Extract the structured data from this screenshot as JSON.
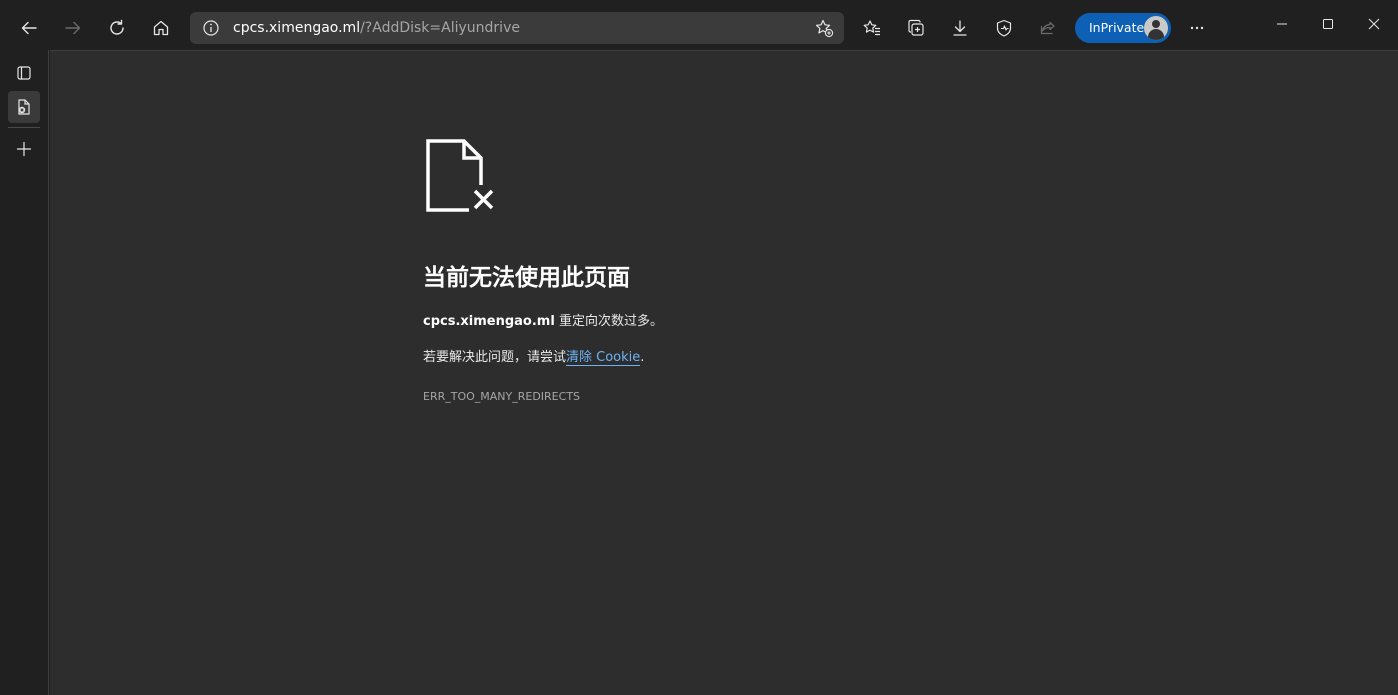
{
  "address_bar": {
    "host": "cpcs.ximengao.ml",
    "path": "/?AddDisk=Aliyundrive"
  },
  "profile": {
    "label": "InPrivate"
  },
  "error": {
    "title": "当前无法使用此页面",
    "host": "cpcs.ximengao.ml",
    "message": " 重定向次数过多。",
    "suggestion_prefix": "若要解决此问题，请尝试",
    "suggestion_link": "清除 Cookie",
    "suggestion_suffix": ".",
    "code": "ERR_TOO_MANY_REDIRECTS"
  },
  "colors": {
    "accent": "#0e60b4",
    "link": "#6cb3f5",
    "page_bg": "#2d2d2d",
    "chrome_bg": "#202020"
  },
  "icons": [
    "back-icon",
    "forward-icon",
    "refresh-icon",
    "home-icon",
    "info-icon",
    "add-favorite-icon",
    "favorites-icon",
    "collections-icon",
    "downloads-icon",
    "browser-essentials-icon",
    "share-icon",
    "more-icon",
    "minimize-icon",
    "maximize-icon",
    "close-icon",
    "tab-actions-icon",
    "tab-favicon-icon",
    "new-tab-icon",
    "page-error-icon"
  ]
}
